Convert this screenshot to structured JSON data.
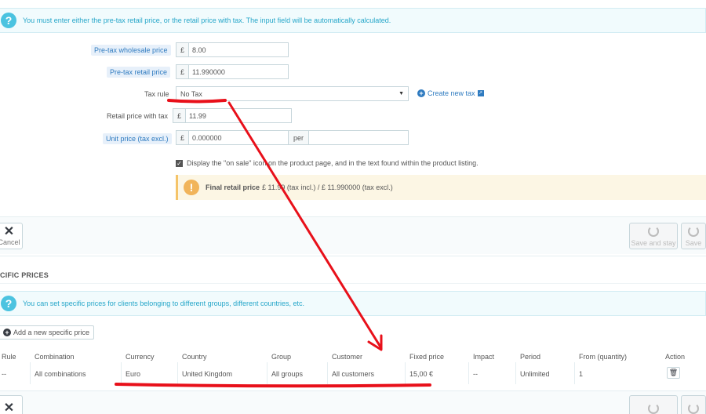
{
  "notices": {
    "tax_info": "You must enter either the pre-tax retail price, or the retail price with tax. The input field will be automatically calculated.",
    "specific_info": "You can set specific prices for clients belonging to different groups, different countries, etc."
  },
  "form": {
    "wholesale": {
      "label": "Pre-tax wholesale price",
      "currency": "£",
      "value": "8.00"
    },
    "retail": {
      "label": "Pre-tax retail price",
      "currency": "£",
      "value": "11.990000"
    },
    "tax_rule": {
      "label": "Tax rule",
      "selected": "No Tax",
      "create_link": "Create new tax"
    },
    "retail_tax": {
      "label": "Retail price with tax",
      "currency": "£",
      "value": "11.99"
    },
    "unit_price": {
      "label": "Unit price (tax excl.)",
      "currency": "£",
      "value": "0.000000",
      "per_label": "per",
      "per_value": ""
    },
    "on_sale": {
      "checked": true,
      "label": "Display the \"on sale\" icon on the product page, and in the text found within the product listing."
    },
    "final": {
      "strong": "Final retail price",
      "text": "£ 11.99 (tax incl.) / £ 11.990000 (tax excl.)"
    }
  },
  "footer": {
    "cancel": "Cancel",
    "save_stay": "Save and stay",
    "save": "Save"
  },
  "specific": {
    "title": "CIFIC PRICES",
    "add_button": "Add a new specific price",
    "columns": [
      "Rule",
      "Combination",
      "Currency",
      "Country",
      "Group",
      "Customer",
      "Fixed price",
      "Impact",
      "Period",
      "From (quantity)",
      "Action"
    ],
    "row": [
      "--",
      "All combinations",
      "Euro",
      "United Kingdom",
      "All groups",
      "All customers",
      "15,00 €",
      "--",
      "Unlimited",
      "1",
      ""
    ]
  },
  "colors": {
    "accent": "#25a6c9",
    "annotation": "#e8101a",
    "warning": "#f1b45a"
  },
  "icons": [
    "question-icon",
    "plus-circle-icon",
    "external-link-icon",
    "check-icon",
    "exclamation-icon",
    "close-icon",
    "refresh-icon",
    "trash-icon",
    "caret-down-icon"
  ]
}
